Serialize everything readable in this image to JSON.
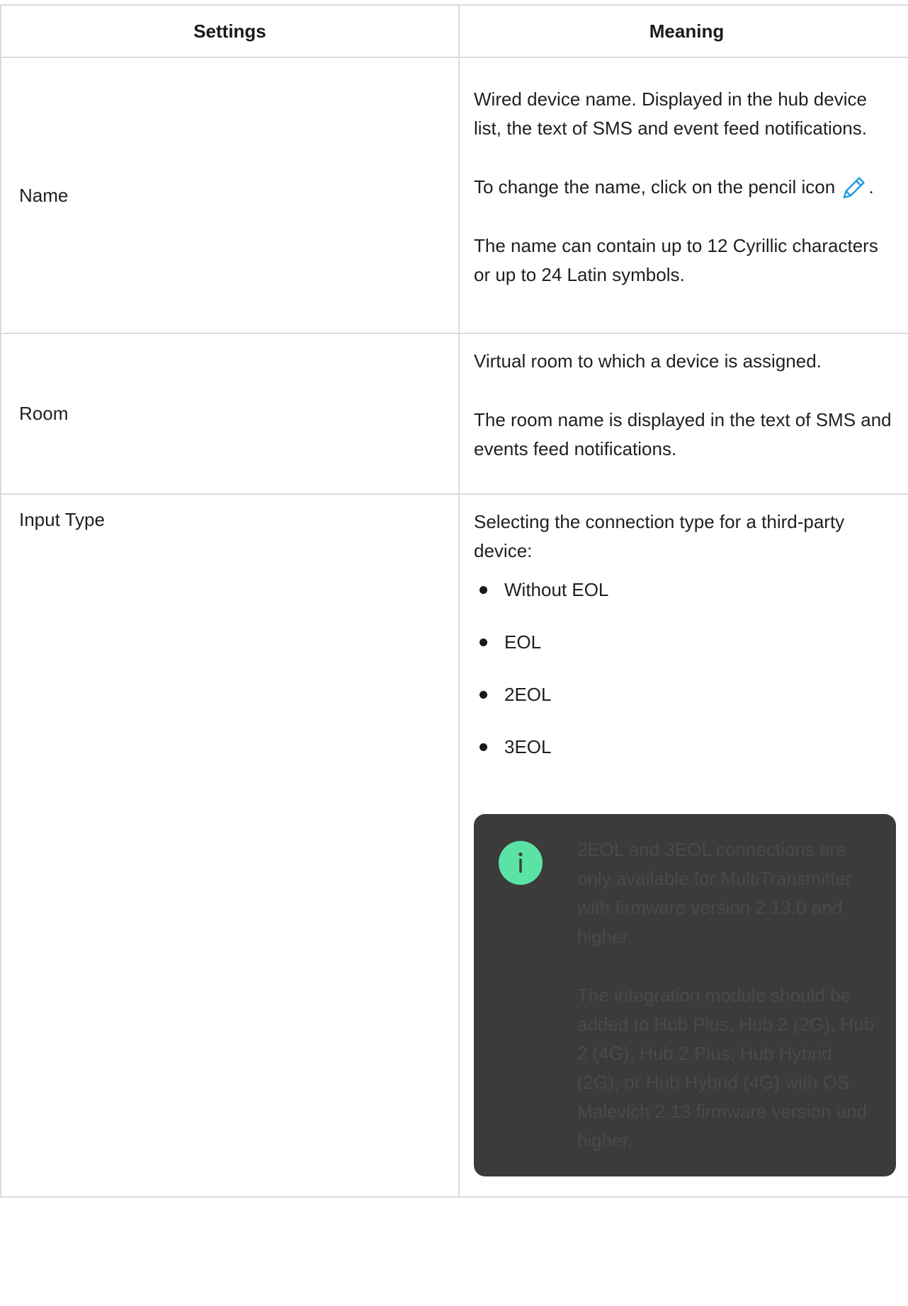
{
  "table": {
    "headers": [
      "Settings",
      "Meaning"
    ],
    "rows": [
      {
        "setting": "Name",
        "meaning": {
          "p1": "Wired device name. Displayed in the hub device list, the text of SMS and event feed notifications.",
          "p2": "To change the name, click on the pencil icon",
          "p2_end": ".",
          "p3": "The name can contain up to 12 Cyrillic characters or up to 24 Latin symbols."
        }
      },
      {
        "setting": "Room",
        "meaning": {
          "p1": "Virtual room to which a device is assigned.",
          "p2": "The room name is displayed in the text of SMS and events feed notifications."
        }
      },
      {
        "setting": "Input Type",
        "meaning": {
          "p1": "Selecting the connection type for a third-party device:",
          "options": [
            "Without EOL",
            "EOL",
            "2EOL",
            "3EOL"
          ],
          "note": {
            "icon": "info-icon",
            "p1": "2EOL and 3EOL connections are only available for MultiTransmitter with firmware version 2.13.0 and higher.",
            "p2": "The integration module should be added to Hub Plus, Hub 2 (2G), Hub 2 (4G), Hub 2 Plus, Hub Hybrid (2G), or Hub Hybrid (4G) with OS Malevich 2.13 firmware version and higher."
          }
        }
      }
    ]
  },
  "colors": {
    "border": "#dcdcdc",
    "pencil_icon": "#1e9be0",
    "note_background": "#3b3b3b",
    "info_icon_background": "#5be3a5"
  }
}
